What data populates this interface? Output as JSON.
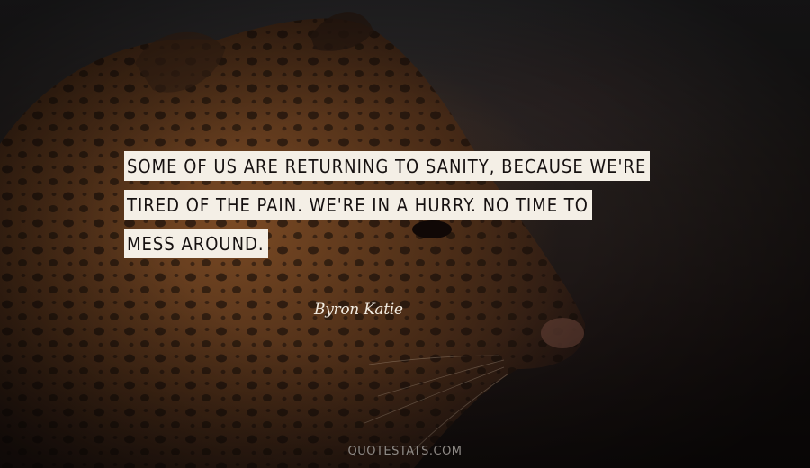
{
  "quote": {
    "lines": [
      "Some of us are returning to sanity, because we're",
      "tired of the pain. We're in a hurry. No time to",
      "mess around."
    ],
    "author": "Byron Katie"
  },
  "footer": {
    "source": "QUOTESTATS.COM"
  },
  "colors": {
    "text_box": "#f4efe6",
    "text": "#161111",
    "author_text": "#f2ece2",
    "background": "#141010"
  }
}
